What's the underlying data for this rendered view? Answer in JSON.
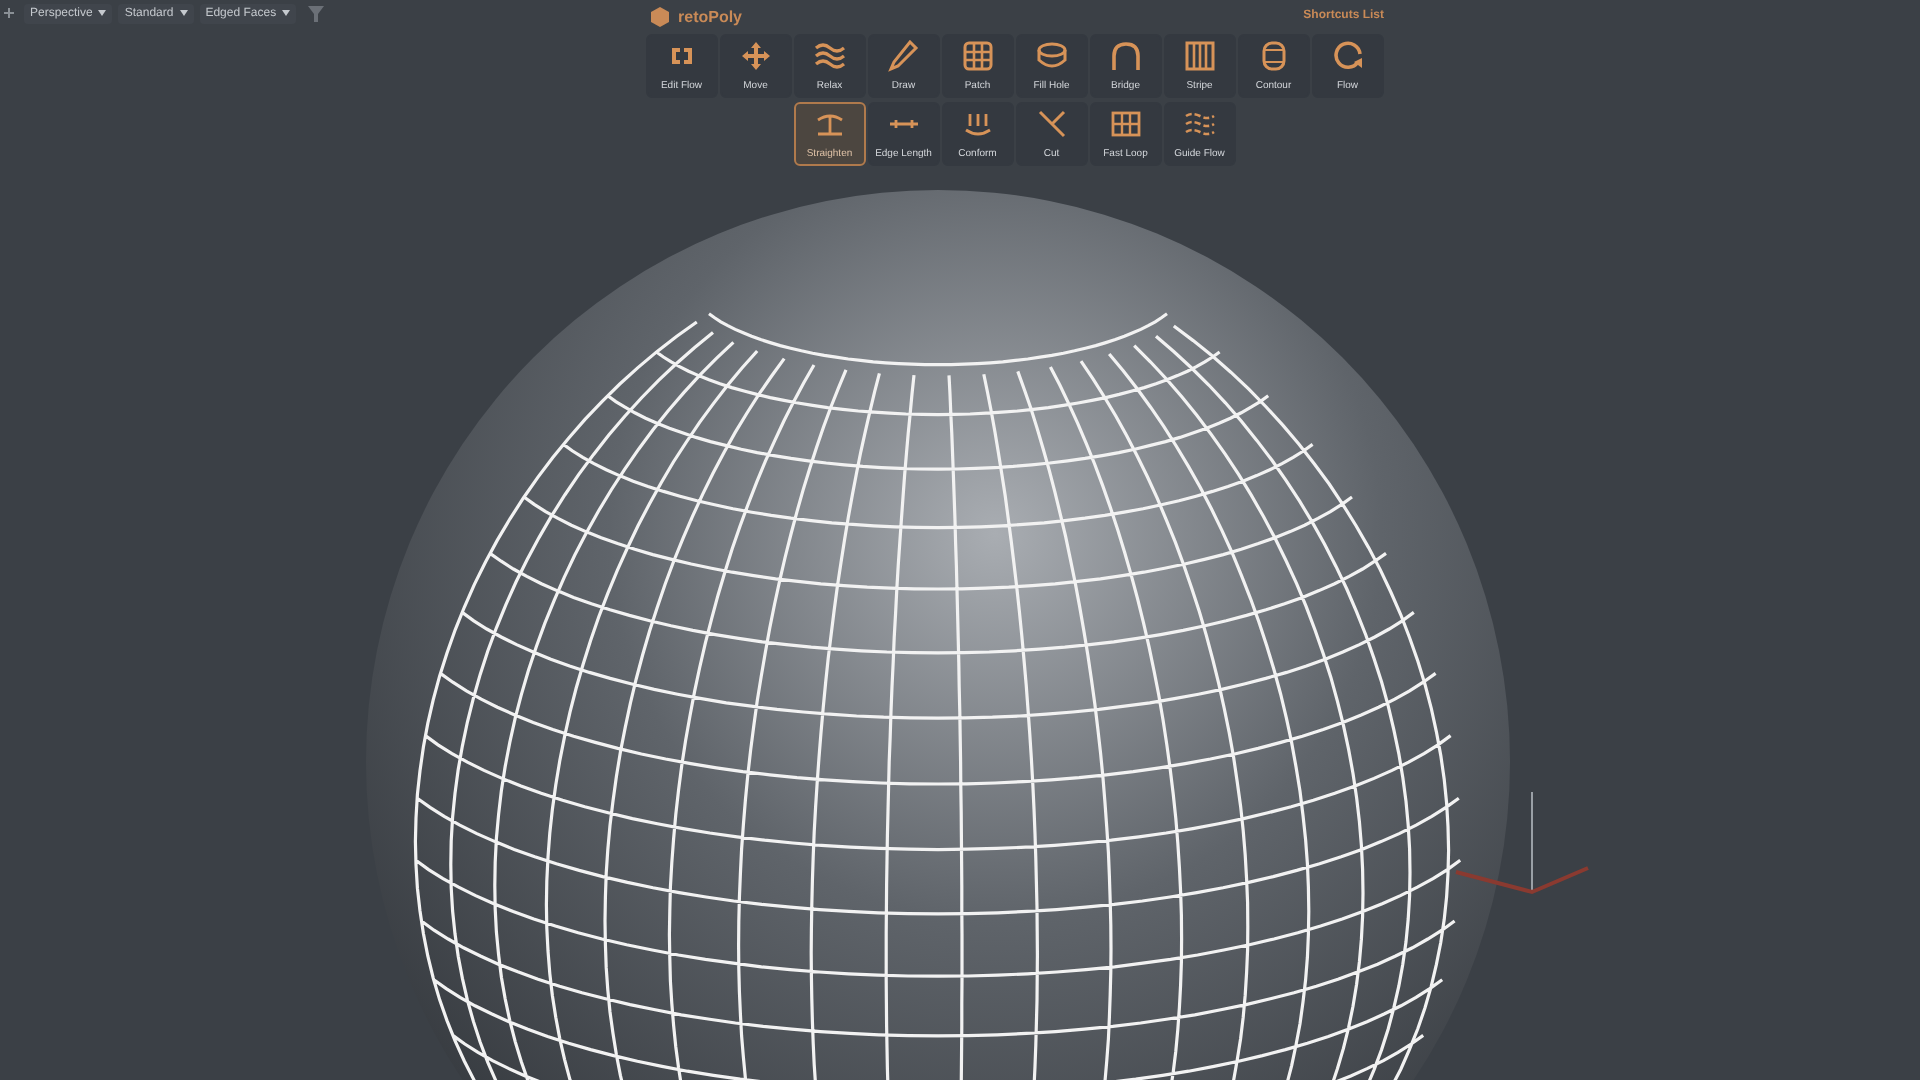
{
  "viewport_menu": [
    {
      "label": "Perspective"
    },
    {
      "label": "Standard"
    },
    {
      "label": "Edged Faces"
    }
  ],
  "toolbar": {
    "title": "retoPoly",
    "shortcuts": "Shortcuts List",
    "main_tools": [
      {
        "label": "Edit Flow",
        "selected": false
      },
      {
        "label": "Move",
        "selected": false
      },
      {
        "label": "Relax",
        "selected": false
      },
      {
        "label": "Draw",
        "selected": false
      },
      {
        "label": "Patch",
        "selected": false
      },
      {
        "label": "Fill Hole",
        "selected": false
      },
      {
        "label": "Bridge",
        "selected": false
      },
      {
        "label": "Stripe",
        "selected": false
      },
      {
        "label": "Contour",
        "selected": false
      },
      {
        "label": "Flow",
        "selected": false
      }
    ],
    "sub_tools": [
      {
        "label": "Straighten",
        "selected": true
      },
      {
        "label": "Edge Length",
        "selected": false
      },
      {
        "label": "Conform",
        "selected": false
      },
      {
        "label": "Cut",
        "selected": false
      },
      {
        "label": "Fast Loop",
        "selected": false
      },
      {
        "label": "Guide Flow",
        "selected": false
      }
    ]
  }
}
